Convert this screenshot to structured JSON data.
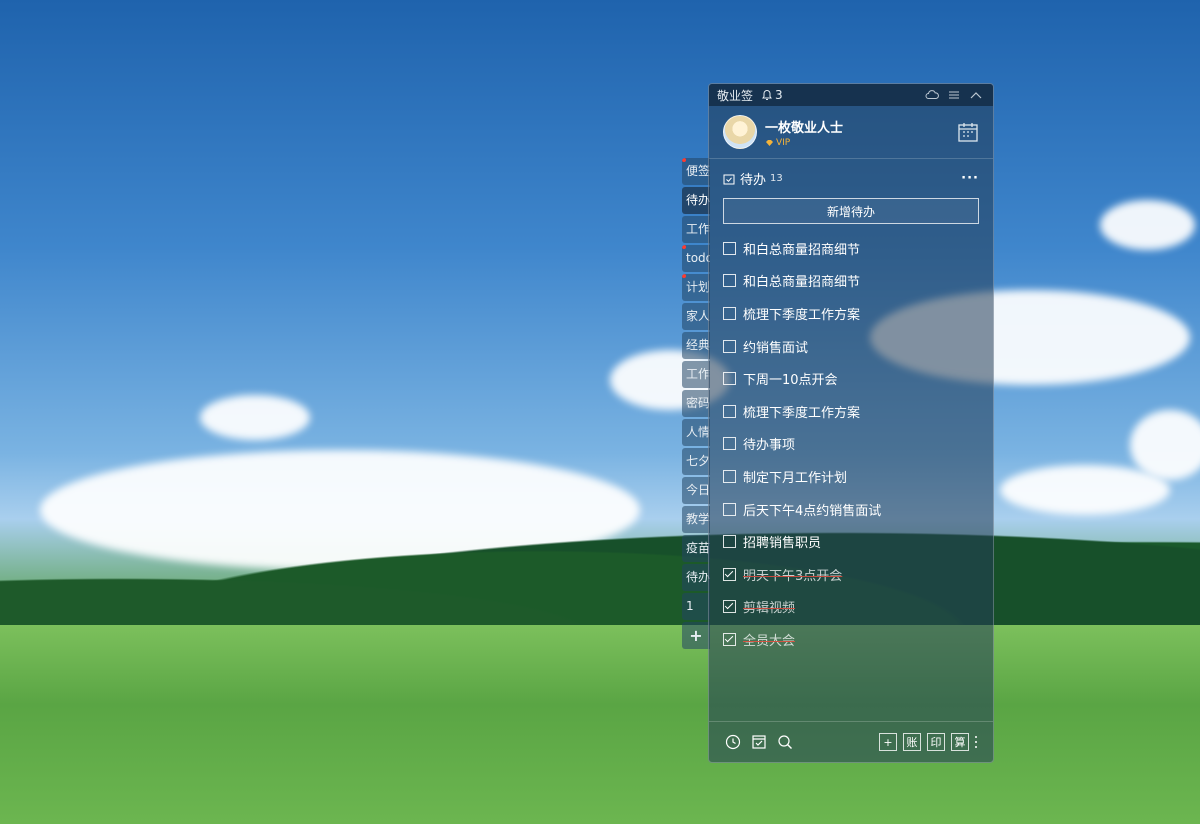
{
  "app": {
    "title": "敬业签",
    "notification_count": "3"
  },
  "user": {
    "name": "一枚敬业人士",
    "badge": "VIP"
  },
  "todo": {
    "section_title": "待办",
    "count": "13",
    "add_label": "新增待办",
    "items": [
      {
        "text": "和白总商量招商细节",
        "done": false
      },
      {
        "text": "和白总商量招商细节",
        "done": false
      },
      {
        "text": "梳理下季度工作方案",
        "done": false
      },
      {
        "text": "约销售面试",
        "done": false
      },
      {
        "text": "下周一10点开会",
        "done": false
      },
      {
        "text": "梳理下季度工作方案",
        "done": false
      },
      {
        "text": "待办事项",
        "done": false
      },
      {
        "text": "制定下月工作计划",
        "done": false
      },
      {
        "text": "后天下午4点约销售面试",
        "done": false
      },
      {
        "text": "招聘销售职员",
        "done": false
      },
      {
        "text": "明天下午3点开会",
        "done": true
      },
      {
        "text": "剪辑视频",
        "done": true
      },
      {
        "text": "全员大会",
        "done": true
      }
    ]
  },
  "side_tabs": [
    {
      "label": "便签",
      "flag": true
    },
    {
      "label": "待办",
      "flag": false,
      "active": true
    },
    {
      "label": "工作",
      "flag": false
    },
    {
      "label": "todo",
      "flag": true
    },
    {
      "label": "计划",
      "flag": true
    },
    {
      "label": "家人",
      "flag": false
    },
    {
      "label": "经典",
      "flag": false
    },
    {
      "label": "工作",
      "flag": false
    },
    {
      "label": "密码",
      "flag": false
    },
    {
      "label": "人情",
      "flag": false
    },
    {
      "label": "七夕",
      "flag": false
    },
    {
      "label": "今日",
      "flag": false
    },
    {
      "label": "教学",
      "flag": false
    },
    {
      "label": "疫苗",
      "flag": false
    },
    {
      "label": "待办",
      "flag": false
    },
    {
      "label": "1",
      "flag": false
    },
    {
      "label": "+",
      "flag": false
    }
  ],
  "footer": {
    "box_labels": [
      "+",
      "账",
      "印",
      "算"
    ]
  },
  "colors": {
    "vip": "#f4b33a",
    "strike": "#ff4b3e",
    "flag": "#ff3b30"
  }
}
